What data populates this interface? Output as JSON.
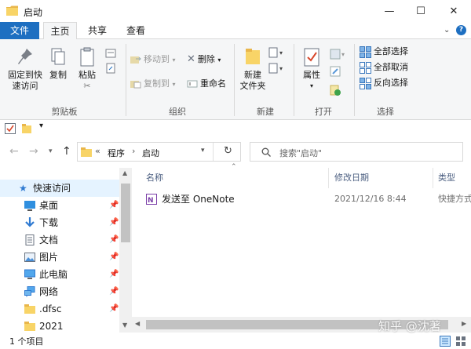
{
  "window": {
    "title": "启动"
  },
  "window_buttons": {
    "minimize": "—",
    "maximize": "☐",
    "close": "✕"
  },
  "tabs": [
    {
      "label": "文件"
    },
    {
      "label": "主页"
    },
    {
      "label": "共享"
    },
    {
      "label": "查看"
    }
  ],
  "ribbon": {
    "pin_quick_access": [
      "固定到快",
      "速访问"
    ],
    "copy": "复制",
    "paste": "粘贴",
    "clipboard_label": "剪贴板",
    "move_to": "移动到",
    "copy_to": "复制到",
    "delete": "删除",
    "rename": "重命名",
    "organize_label": "组织",
    "new_folder": [
      "新建",
      "文件夹"
    ],
    "new_label": "新建",
    "properties": "属性",
    "open_label": "打开",
    "select_all": "全部选择",
    "select_none": "全部取消",
    "invert_selection": "反向选择",
    "select_label": "选择"
  },
  "address": {
    "overflow": "«",
    "crumbs": [
      "程序",
      "启动"
    ],
    "sep": "›"
  },
  "search": {
    "placeholder": "搜索\"启动\""
  },
  "nav": {
    "items": [
      {
        "label": "快速访问",
        "pinned": false
      },
      {
        "label": "桌面",
        "pinned": true
      },
      {
        "label": "下载",
        "pinned": true
      },
      {
        "label": "文档",
        "pinned": true
      },
      {
        "label": "图片",
        "pinned": true
      },
      {
        "label": "此电脑",
        "pinned": true
      },
      {
        "label": "网络",
        "pinned": true
      },
      {
        "label": ".dfsc",
        "pinned": true
      },
      {
        "label": "2021",
        "pinned": false
      }
    ]
  },
  "columns": {
    "name": "名称",
    "modified": "修改日期",
    "type": "类型"
  },
  "files": [
    {
      "name": "发送至 OneNote",
      "modified": "2021/12/16 8:44",
      "type": "快捷方式"
    }
  ],
  "status": {
    "count": "1 个项目"
  },
  "watermark": "知乎 @沈著",
  "colors": {
    "accent": "#1e6fc1",
    "selection": "#e5f3ff",
    "folder": "#f8d467"
  }
}
